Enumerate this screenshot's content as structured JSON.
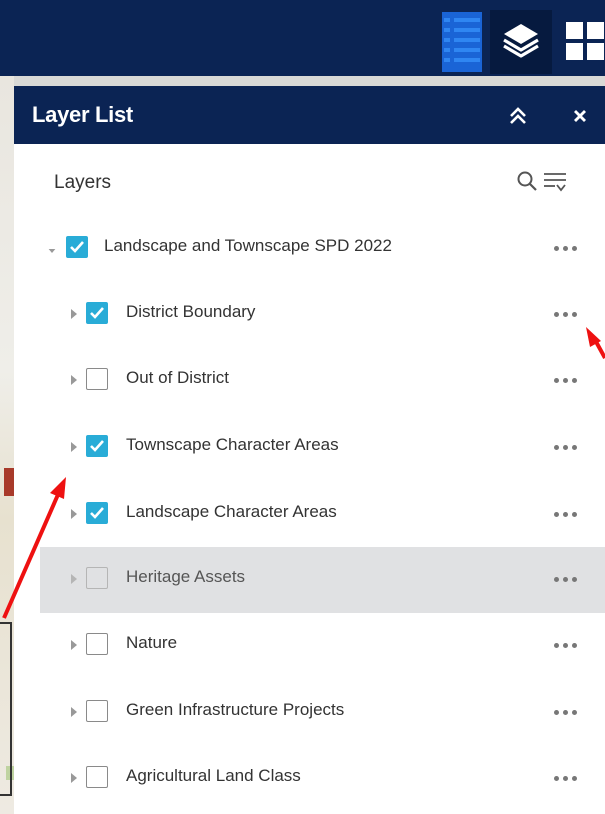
{
  "app": {
    "toolbar": {
      "buttons": [
        {
          "icon": "list-icon",
          "state": "inactive"
        },
        {
          "icon": "layers-stack-icon",
          "state": "active"
        },
        {
          "icon": "grid-apps-icon",
          "state": "inactive"
        }
      ]
    }
  },
  "panel": {
    "title": "Layer List",
    "collapse_icon": "double-chevron-up-icon",
    "close_label": "×"
  },
  "layers_header": {
    "label": "Layers",
    "search_icon": "search-icon",
    "filter_icon": "filter-lines-icon"
  },
  "layers": [
    {
      "label": "Landscape and Townscape SPD 2022",
      "checked": true,
      "expanded": true,
      "level": 0
    },
    {
      "label": "District Boundary",
      "checked": true,
      "expanded": false,
      "level": 1
    },
    {
      "label": "Out of District",
      "checked": false,
      "expanded": false,
      "level": 1
    },
    {
      "label": "Townscape Character Areas",
      "checked": true,
      "expanded": false,
      "level": 1
    },
    {
      "label": "Landscape Character Areas",
      "checked": true,
      "expanded": false,
      "level": 1
    },
    {
      "label": "Heritage Assets",
      "checked": false,
      "expanded": false,
      "level": 1,
      "highlighted": true
    },
    {
      "label": "Nature",
      "checked": false,
      "expanded": false,
      "level": 1
    },
    {
      "label": "Green Infrastructure Projects",
      "checked": false,
      "expanded": false,
      "level": 1
    },
    {
      "label": "Agricultural Land Class",
      "checked": false,
      "expanded": false,
      "level": 1
    }
  ],
  "colors": {
    "header_bg": "#0b2454",
    "checkbox_checked": "#29acd7",
    "row_highlight": "#e0e1e3",
    "annotation_arrow": "#ee1111"
  }
}
